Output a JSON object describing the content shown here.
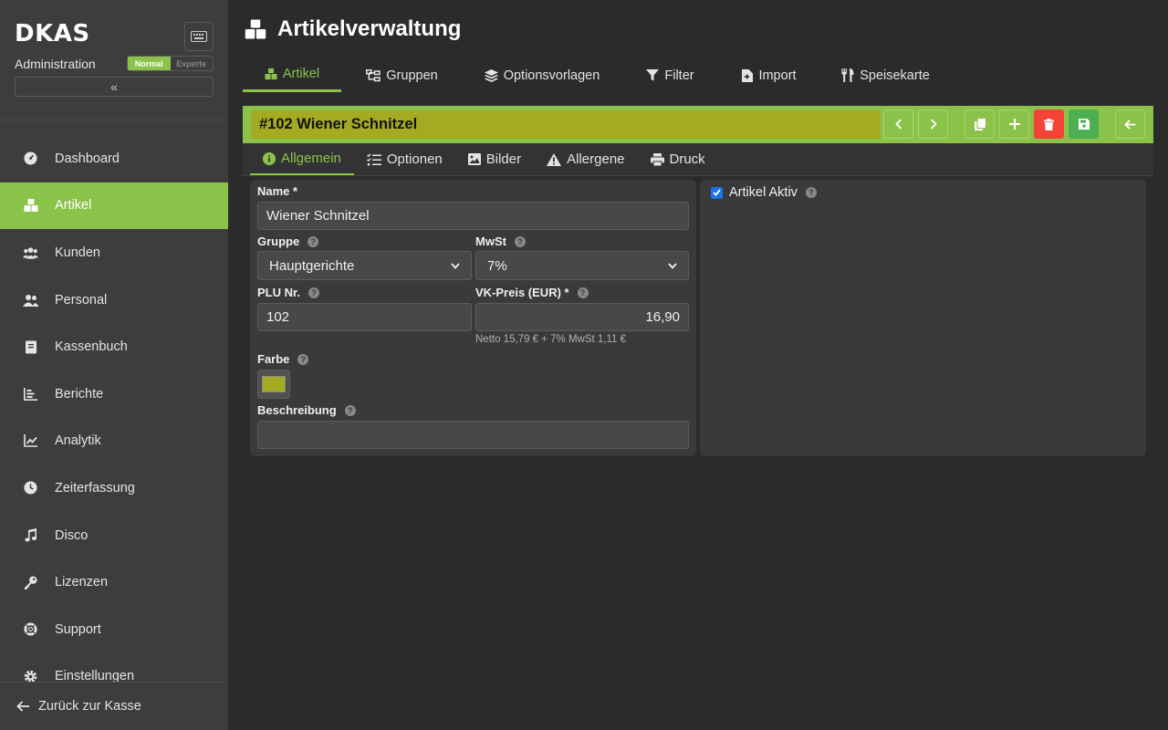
{
  "brand": {
    "logo": "DKAS",
    "subtitle": "Administration"
  },
  "mode": {
    "normal": "Normal",
    "expert": "Experte",
    "selected": "Normal"
  },
  "sidebar": {
    "items": [
      {
        "label": "Dashboard",
        "icon": "gauge-icon"
      },
      {
        "label": "Artikel",
        "icon": "boxes-icon",
        "active": true
      },
      {
        "label": "Kunden",
        "icon": "users-icon"
      },
      {
        "label": "Personal",
        "icon": "user-group-icon"
      },
      {
        "label": "Kassenbuch",
        "icon": "book-icon"
      },
      {
        "label": "Berichte",
        "icon": "bar-chart-icon"
      },
      {
        "label": "Analytik",
        "icon": "line-chart-icon"
      },
      {
        "label": "Zeiterfassung",
        "icon": "clock-icon"
      },
      {
        "label": "Disco",
        "icon": "music-icon"
      },
      {
        "label": "Lizenzen",
        "icon": "key-icon"
      },
      {
        "label": "Support",
        "icon": "lifebuoy-icon"
      },
      {
        "label": "Einstellungen",
        "icon": "gear-icon"
      }
    ],
    "footer": "Zurück zur Kasse"
  },
  "header": {
    "title": "Artikelverwaltung",
    "tabs": [
      {
        "label": "Artikel",
        "active": true
      },
      {
        "label": "Gruppen"
      },
      {
        "label": "Optionsvorlagen"
      },
      {
        "label": "Filter"
      },
      {
        "label": "Import"
      },
      {
        "label": "Speisekarte"
      }
    ]
  },
  "item": {
    "title": "#102 Wiener Schnitzel",
    "color": "#a4ab22"
  },
  "subtabs": [
    {
      "label": "Allgemein",
      "active": true
    },
    {
      "label": "Optionen"
    },
    {
      "label": "Bilder"
    },
    {
      "label": "Allergene"
    },
    {
      "label": "Druck"
    }
  ],
  "form": {
    "name_label": "Name *",
    "name_value": "Wiener Schnitzel",
    "group_label": "Gruppe",
    "group_value": "Hauptgerichte",
    "vat_label": "MwSt",
    "vat_value": "7%",
    "plu_label": "PLU Nr.",
    "plu_value": "102",
    "price_label": "VK-Preis (EUR) *",
    "price_value": "16,90",
    "price_hint": "Netto 15,79 € + 7% MwSt 1,11 €",
    "color_label": "Farbe",
    "desc_label": "Beschreibung",
    "desc_value": "",
    "active_label": "Artikel Aktiv",
    "active_checked": true
  },
  "colors": {
    "accent": "#8bc34a",
    "delete": "#f44336",
    "save": "#4caf50",
    "background": "#2b2b2b",
    "sidebar": "#3d3d3d"
  }
}
